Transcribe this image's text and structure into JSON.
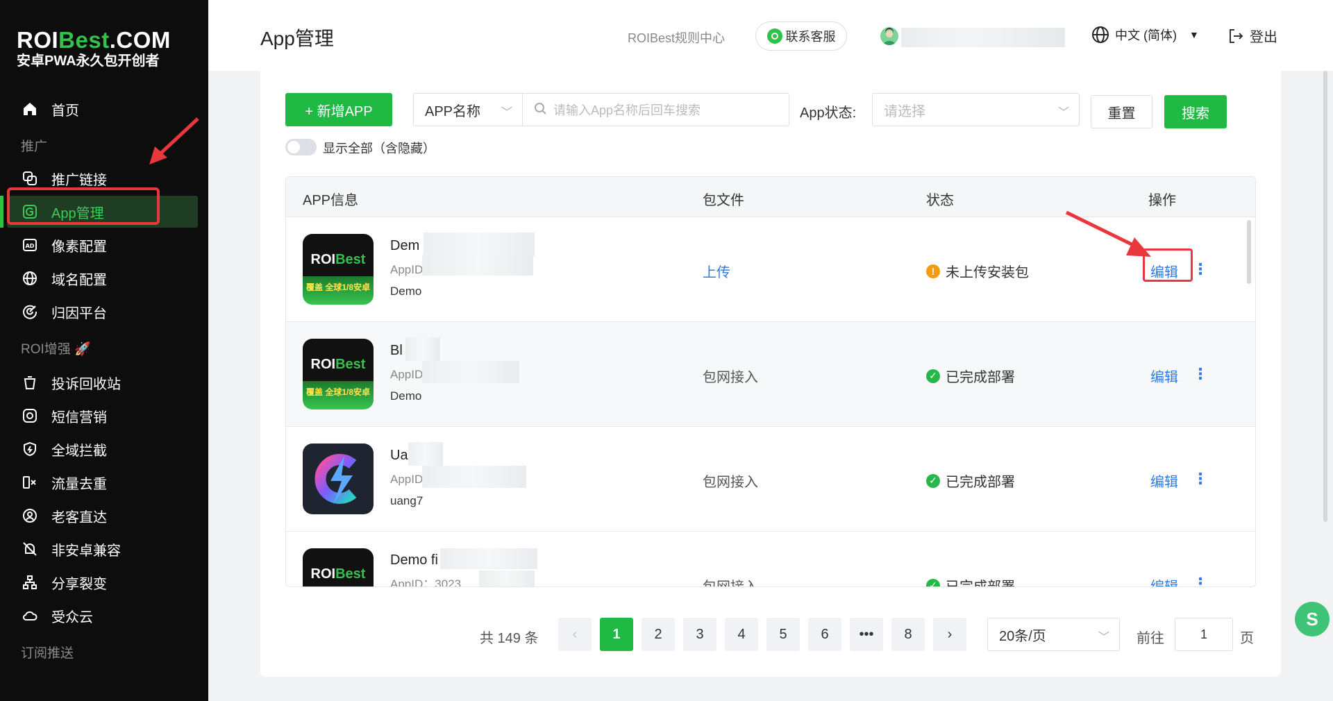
{
  "brand": {
    "logo_prefix": "ROI",
    "logo_mid": "Best",
    "logo_suffix": ".COM",
    "tagline": "安卓PWA永久包开创者"
  },
  "sidebar": {
    "items": [
      {
        "label": "首页",
        "icon": "home-icon"
      },
      {
        "group": "推广"
      },
      {
        "label": "推广链接",
        "icon": "link-icon"
      },
      {
        "label": "App管理",
        "icon": "app-icon",
        "active": true
      },
      {
        "label": "像素配置",
        "icon": "ad-icon"
      },
      {
        "label": "域名配置",
        "icon": "globe-icon"
      },
      {
        "label": "归因平台",
        "icon": "target-icon"
      },
      {
        "group": "ROI增强"
      },
      {
        "label": "投诉回收站",
        "icon": "trash-icon"
      },
      {
        "label": "短信营销",
        "icon": "sms-icon"
      },
      {
        "label": "全域拦截",
        "icon": "shield-icon"
      },
      {
        "label": "流量去重",
        "icon": "dedupe-icon"
      },
      {
        "label": "老客直达",
        "icon": "user-return-icon"
      },
      {
        "label": "非安卓兼容",
        "icon": "android-off-icon"
      },
      {
        "label": "分享裂变",
        "icon": "share-tree-icon"
      },
      {
        "label": "受众云",
        "icon": "cloud-icon"
      },
      {
        "group": "订阅推送"
      }
    ]
  },
  "header": {
    "title": "App管理",
    "rule_center": "ROIBest规则中心",
    "support": "联系客服",
    "language": "中文 (简体)",
    "logout": "登出"
  },
  "filters": {
    "add_button": "+ 新增APP",
    "field_select": "APP名称",
    "search_placeholder": "请输入App名称后回车搜索",
    "status_label": "App状态:",
    "status_placeholder": "请选择",
    "reset": "重置",
    "search": "搜索",
    "show_all_label": "显示全部（含隐藏）",
    "show_all_on": false
  },
  "table": {
    "headers": [
      "APP信息",
      "包文件",
      "状态",
      "操作"
    ],
    "rows": [
      {
        "name": "Dem",
        "appid": "AppID：8",
        "package": "Demo",
        "file": "上传",
        "file_is_link": true,
        "status": "未上传安装包",
        "status_type": "warning",
        "action": "编辑"
      },
      {
        "name": "Bl",
        "appid": "AppID：6",
        "package": "Demo",
        "file": "包网接入",
        "file_is_link": false,
        "status": "已完成部署",
        "status_type": "success",
        "action": "编辑"
      },
      {
        "name": "Ua",
        "appid": "AppID：9",
        "package": "uang7",
        "file": "包网接入",
        "file_is_link": false,
        "status": "已完成部署",
        "status_type": "success",
        "action": "编辑"
      },
      {
        "name": "Demo fi",
        "appid": "AppID：3023",
        "package": "",
        "file": "包网接入",
        "file_is_link": false,
        "status": "已完成部署",
        "status_type": "success",
        "action": "编辑"
      }
    ],
    "icon_text": {
      "brand_a": "ROI",
      "brand_b": "Best",
      "slogan": "覆盖 全球1/8安卓"
    }
  },
  "pagination": {
    "total_text": "共 149 条",
    "pages": [
      "1",
      "2",
      "3",
      "4",
      "5",
      "6",
      "•••",
      "8"
    ],
    "current": "1",
    "page_size": "20条/页",
    "goto_label": "前往",
    "goto_value": "1",
    "goto_suffix": "页"
  },
  "colors": {
    "primary": "#1fb943",
    "link": "#2e7be6",
    "warning": "#f39c12",
    "annotation": "#e8383d",
    "sidebar_bg": "#0d0d0d"
  }
}
